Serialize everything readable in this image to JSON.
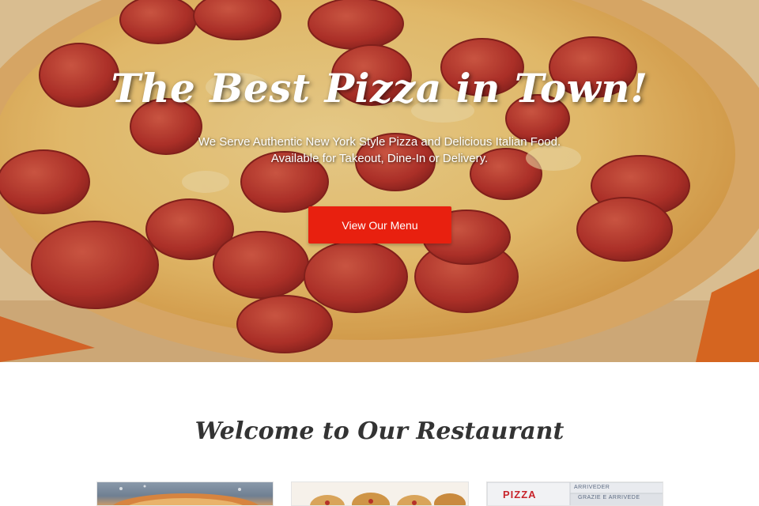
{
  "hero": {
    "title": "The Best Pizza in Town!",
    "subtitle_line1": "We Serve Authentic New York Style Pizza and Delicious Italian Food.",
    "subtitle_line2": "Available for Takeout, Dine-In or Delivery.",
    "cta_label": "View Our Menu"
  },
  "welcome": {
    "title": "Welcome to Our Restaurant"
  },
  "cards": [
    {
      "name": "card-pizza-photo"
    },
    {
      "name": "card-pizza-rolls-photo"
    },
    {
      "name": "card-pizza-boxes-photo",
      "box_label": "PIZZA",
      "box_text_1": "ARRIVEDER",
      "box_text_2": "GRAZIE E ARRIVEDE"
    }
  ],
  "colors": {
    "accent": "#e8200f",
    "heading": "#333333",
    "hero_text": "#ffffff"
  }
}
